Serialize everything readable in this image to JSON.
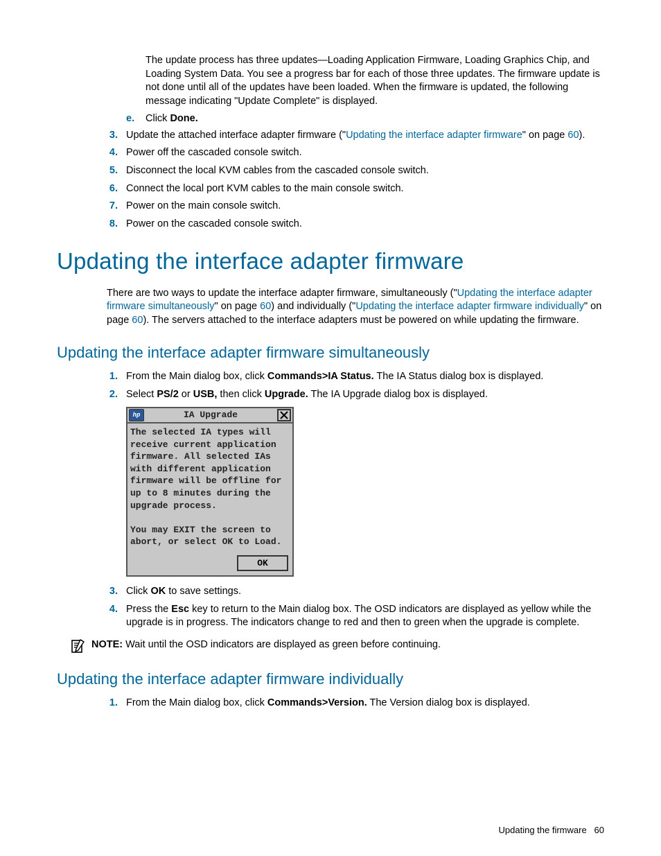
{
  "top_para": "The update process has three updates—Loading Application Firmware, Loading Graphics Chip, and Loading System Data. You see a progress bar for each of those three updates. The firmware update is not done until all of the updates have been loaded. When the firmware is updated, the following message indicating \"Update Complete\" is displayed.",
  "sub_e": {
    "marker": "e.",
    "pre": "Click ",
    "bold": "Done."
  },
  "steps_a": {
    "s3": {
      "marker": "3.",
      "pre": "Update the attached interface adapter firmware (\"",
      "link": "Updating the interface adapter firmware",
      "post1": "\" on page ",
      "page": "60",
      "post2": ")."
    },
    "s4": {
      "marker": "4.",
      "text": "Power off the cascaded console switch."
    },
    "s5": {
      "marker": "5.",
      "text": "Disconnect the local KVM cables from the cascaded console switch."
    },
    "s6": {
      "marker": "6.",
      "text": "Connect the local port KVM cables to the main console switch."
    },
    "s7": {
      "marker": "7.",
      "text": "Power on the main console switch."
    },
    "s8": {
      "marker": "8.",
      "text": "Power on the cascaded console switch."
    }
  },
  "h1": "Updating the interface adapter firmware",
  "intro": {
    "pre": "There are two ways to update the interface adapter firmware, simultaneously (\"",
    "link1": "Updating the interface adapter firmware simultaneously",
    "mid1": "\" on page ",
    "page1": "60",
    "mid2": ") and individually (\"",
    "link2": "Updating the interface adapter firmware individually",
    "mid3": "\" on page ",
    "page2": "60",
    "post": "). The servers attached to the interface adapters must be powered on while updating the firmware."
  },
  "h2a": "Updating the interface adapter firmware simultaneously",
  "steps_b": {
    "s1": {
      "marker": "1.",
      "pre": "From the Main dialog box, click ",
      "bold": "Commands>IA Status.",
      "post": " The IA Status dialog box is displayed."
    },
    "s2": {
      "marker": "2.",
      "pre": "Select ",
      "b1": "PS/2",
      "mid1": " or ",
      "b2": "USB,",
      "mid2": " then click ",
      "b3": "Upgrade.",
      "post": " The IA Upgrade dialog box is displayed."
    },
    "s3": {
      "marker": "3.",
      "pre": "Click ",
      "bold": "OK",
      "post": " to save settings."
    },
    "s4": {
      "marker": "4.",
      "pre": "Press the ",
      "bold": "Esc",
      "post": " key to return to the Main dialog box. The OSD indicators are displayed as yellow while the upgrade is in progress. The indicators change to red and then to green when the upgrade is complete."
    }
  },
  "dialog": {
    "title": "IA Upgrade",
    "lines": [
      "The selected IA types will",
      "receive current application",
      "firmware. All selected IAs",
      "with different application",
      "firmware will be offline for",
      "up to 8 minutes during the",
      "upgrade process.",
      "",
      "You may EXIT the screen to",
      "abort, or select OK to Load."
    ],
    "ok": "OK"
  },
  "note": {
    "label": "NOTE:",
    "text": "  Wait until the OSD indicators are displayed as green before continuing."
  },
  "h2b": "Updating the interface adapter firmware individually",
  "steps_c": {
    "s1": {
      "marker": "1.",
      "pre": "From the Main dialog box, click ",
      "bold": "Commands>Version.",
      "post": " The Version dialog box is displayed."
    }
  },
  "footer": {
    "text": "Updating the firmware",
    "page": "60"
  }
}
